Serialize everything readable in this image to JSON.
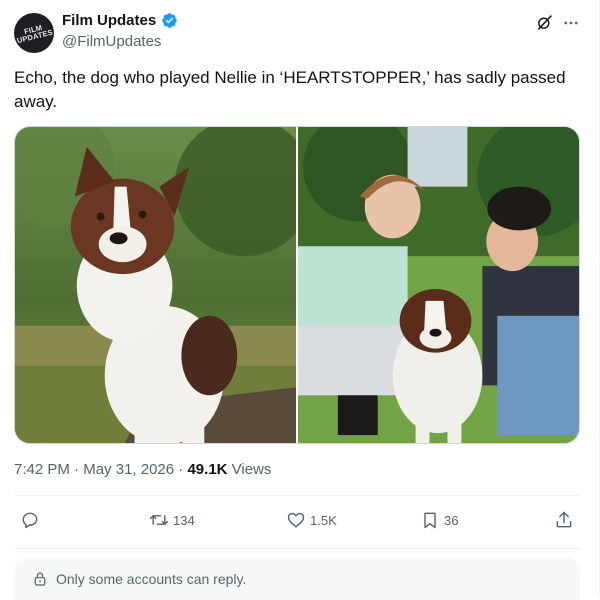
{
  "author": {
    "display_name": "Film Updates",
    "handle": "@FilmUpdates",
    "avatar_text": "FILM UPDATES",
    "verified": true
  },
  "tweet": {
    "text": "Echo, the dog who played Nellie in ‘HEARTSTOPPER,’ has sadly passed away."
  },
  "media": [
    {
      "description_icon": "photo-dog"
    },
    {
      "description_icon": "photo-actors-with-dog"
    }
  ],
  "meta": {
    "time": "7:42 PM",
    "separator": "·",
    "date": "May 31, 2026",
    "views_count": "49.1K",
    "views_label": "Views"
  },
  "actions": {
    "reply_count": "",
    "retweet_count": "134",
    "like_count": "1.5K",
    "bookmark_count": "36"
  },
  "reply_restriction": {
    "text": "Only some accounts can reply."
  },
  "colors": {
    "accent": "#1d9bf0",
    "text_primary": "#0f1419",
    "text_secondary": "#536471",
    "border": "#eff3f4"
  }
}
